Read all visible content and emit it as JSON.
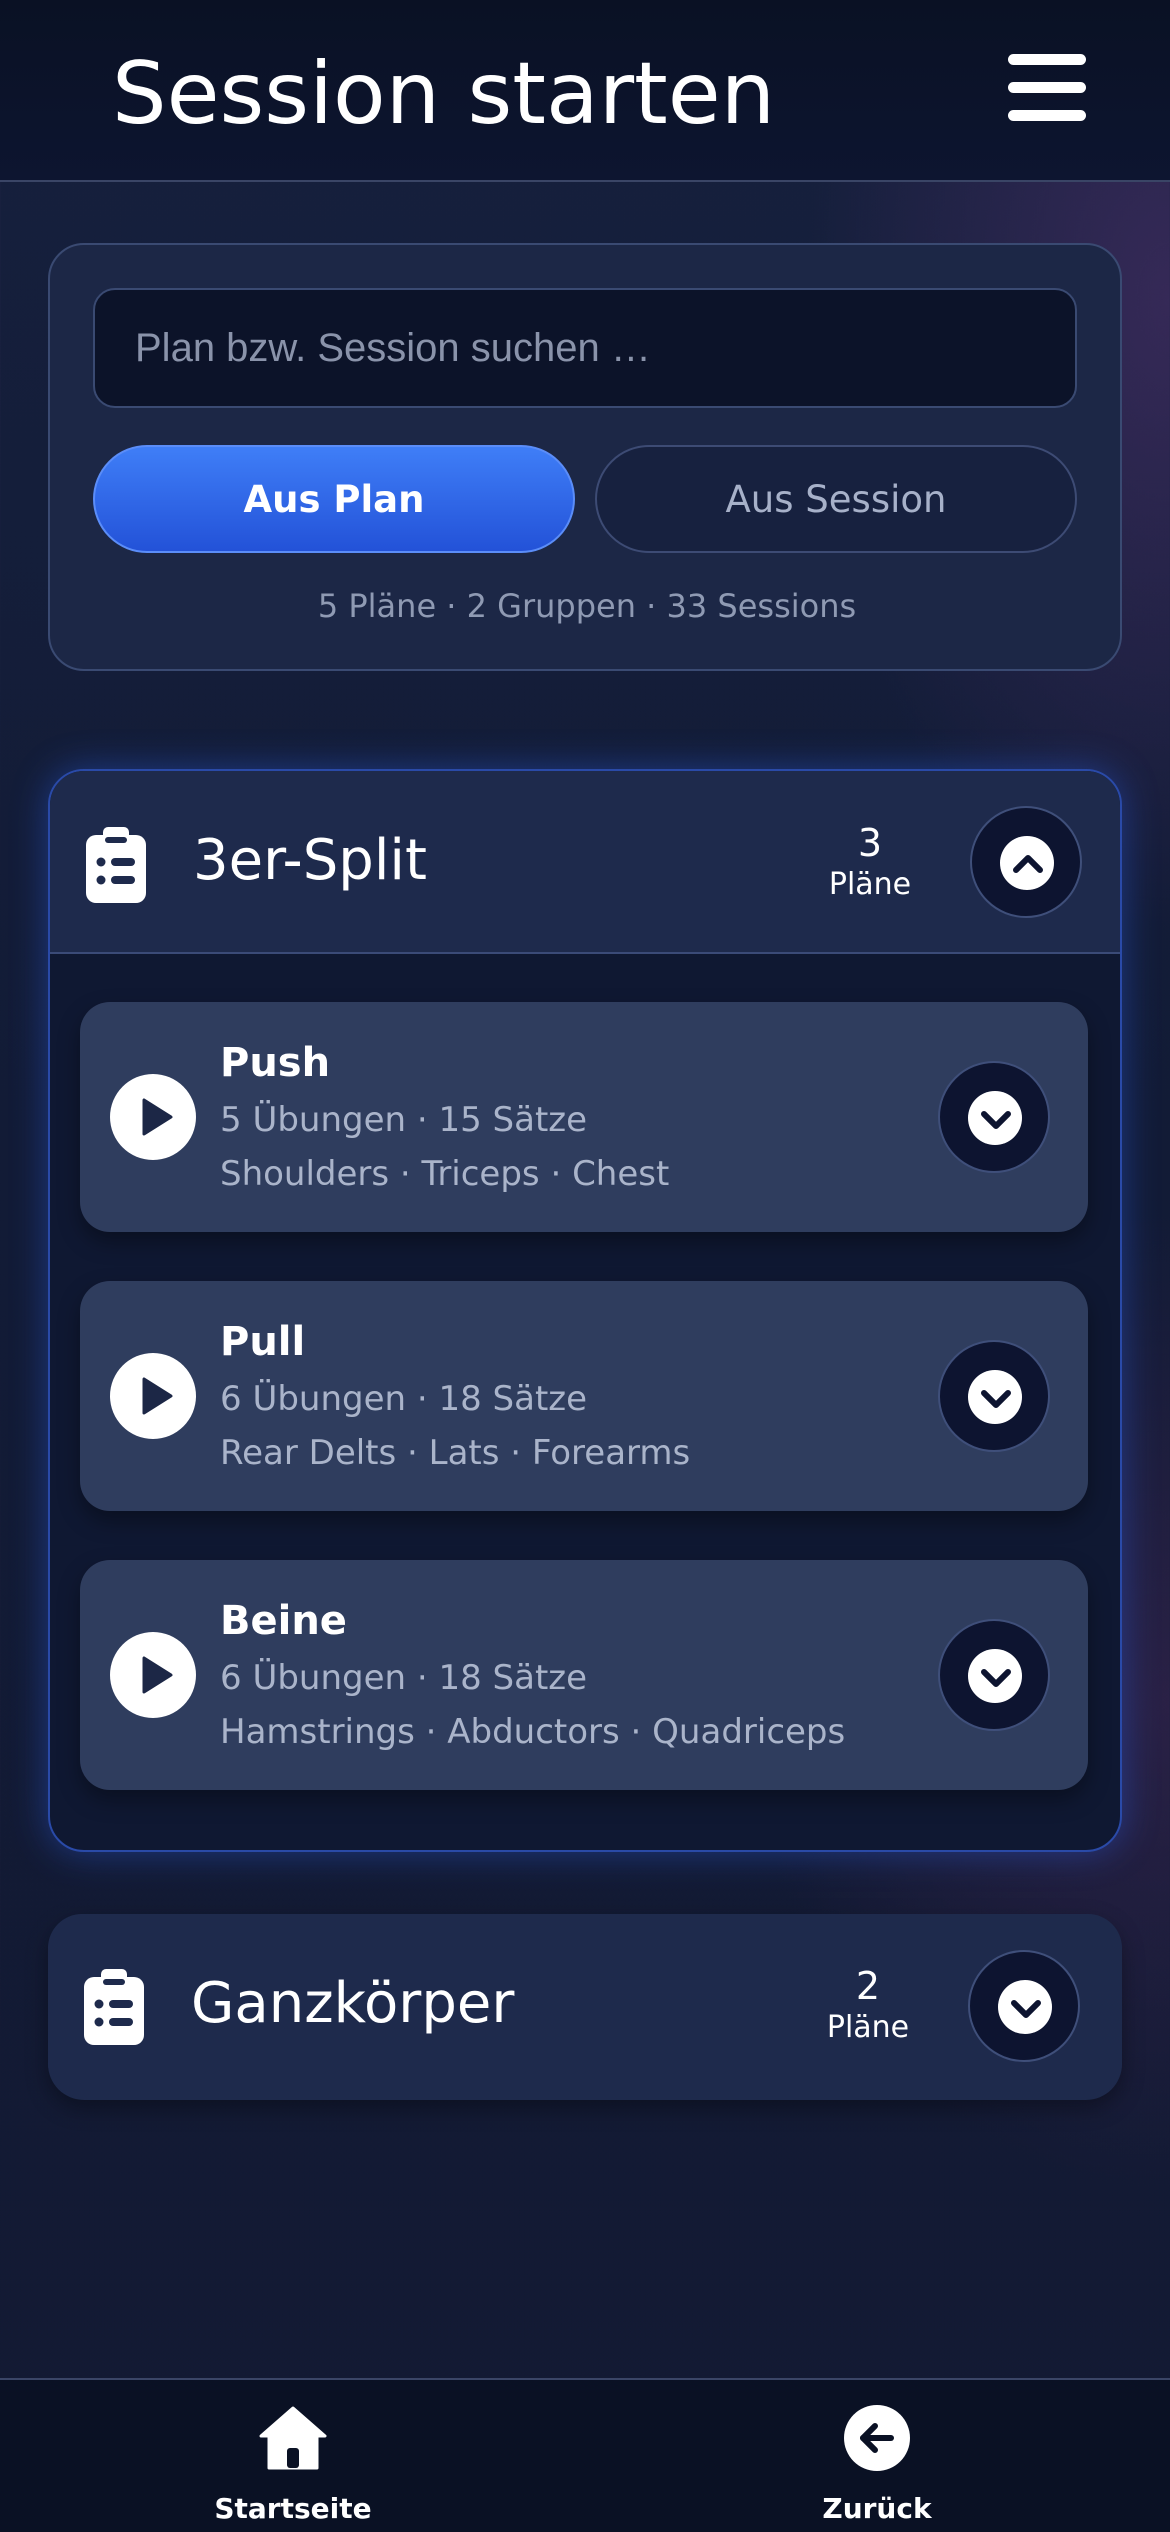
{
  "header": {
    "title": "Session starten",
    "menu_icon": "hamburger-menu-icon"
  },
  "search": {
    "placeholder": "Plan bzw. Session suchen …",
    "value": "",
    "toggle_plan": "Aus Plan",
    "toggle_session": "Aus Session",
    "active_toggle": "Aus Plan",
    "stats": "5 Pläne · 2 Gruppen · 33 Sessions"
  },
  "groups": [
    {
      "name": "3er-Split",
      "count": "3",
      "count_label": "Pläne",
      "icon": "clipboard-list-icon",
      "expanded": true,
      "plans": [
        {
          "name": "Push",
          "meta": "5 Übungen · 15 Sätze",
          "muscles": "Shoulders · Triceps · Chest"
        },
        {
          "name": "Pull",
          "meta": "6 Übungen · 18 Sätze",
          "muscles": "Rear Delts · Lats · Forearms"
        },
        {
          "name": "Beine",
          "meta": "6 Übungen · 18 Sätze",
          "muscles": "Hamstrings · Abductors · Quadriceps"
        }
      ]
    },
    {
      "name": "Ganzkörper",
      "count": "2",
      "count_label": "Pläne",
      "icon": "clipboard-list-icon",
      "expanded": false,
      "plans": []
    }
  ],
  "bottom_nav": {
    "home_label": "Startseite",
    "home_icon": "home-icon",
    "back_label": "Zurück",
    "back_icon": "arrow-left-circle-icon"
  },
  "colors": {
    "accent": "#3f7ef7",
    "background": "#121b36",
    "card": "#2f3d5e"
  }
}
